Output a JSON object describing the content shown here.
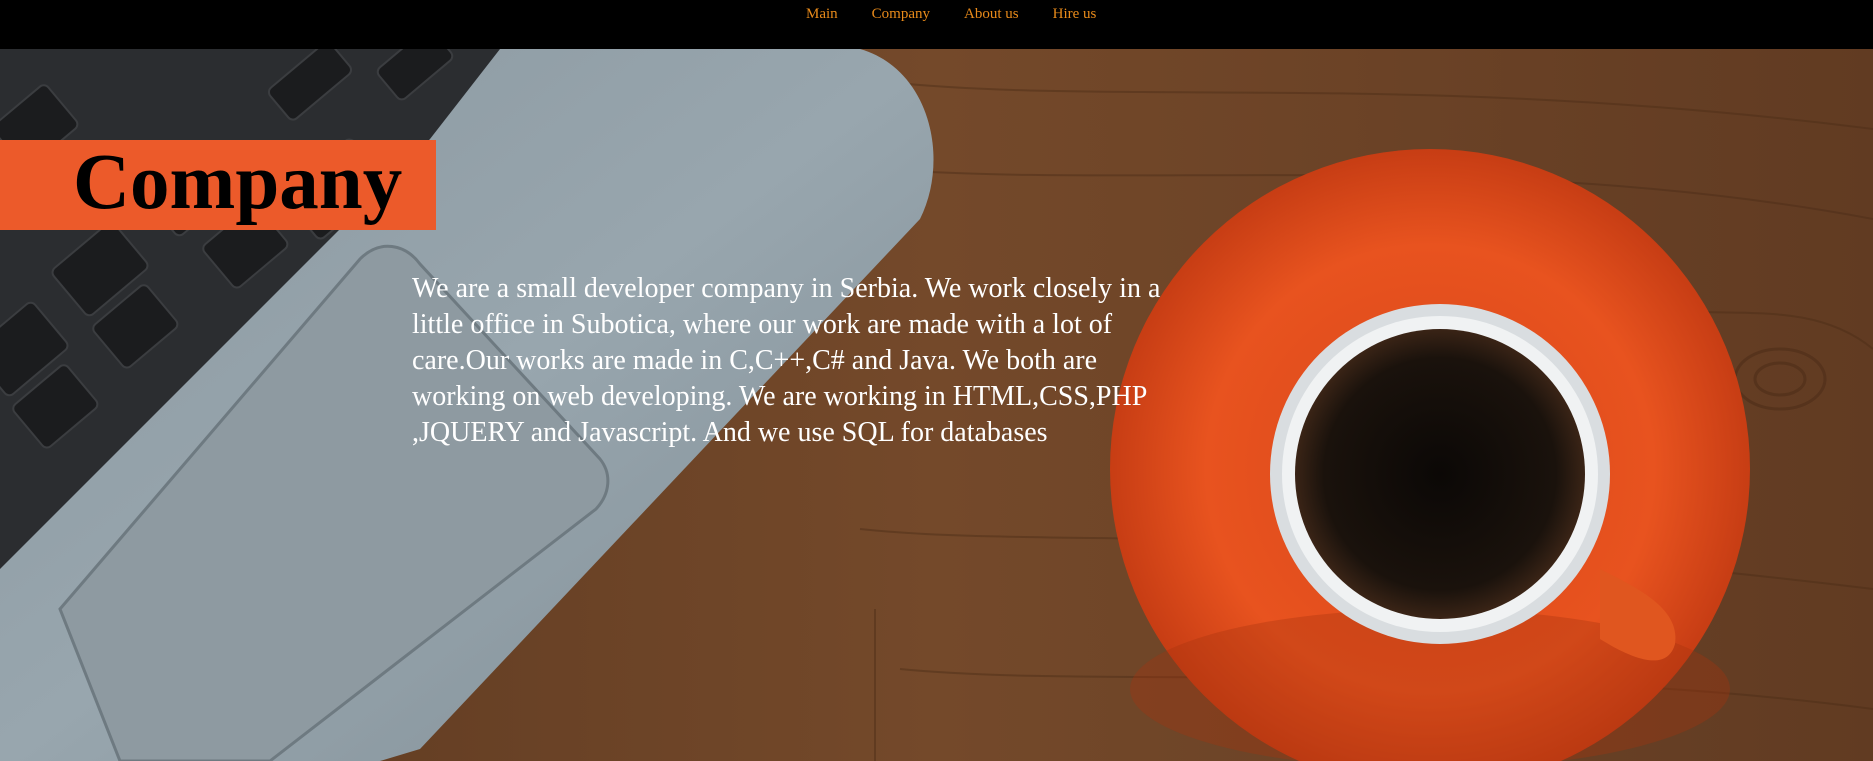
{
  "nav": {
    "items": [
      {
        "label": "Main"
      },
      {
        "label": "Company"
      },
      {
        "label": "About us"
      },
      {
        "label": "Hire us"
      }
    ],
    "link_color": "#e88a1a",
    "background": "#000000"
  },
  "hero": {
    "title": "Company",
    "title_badge_color": "#ec5a2a",
    "description": "We are a small developer company in Serbia. We work closely in a little office in Subotica, where our work are made with a lot of care.Our works are made in C,C++,C# and Java. We both are working on web developing. We are working in HTML,CSS,PHP ,JQUERY and Javascript. And we use SQL for databases",
    "background_image": "laptop-and-coffee-cup-on-wooden-desk"
  }
}
